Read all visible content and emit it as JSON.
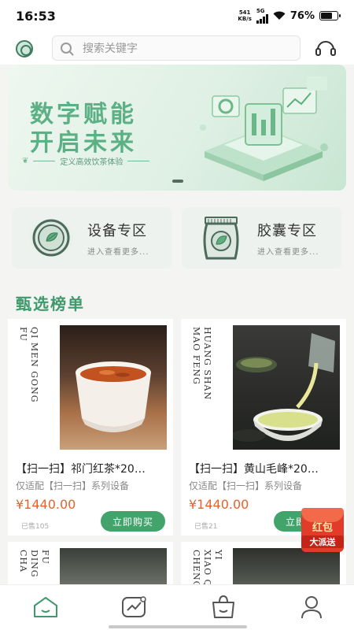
{
  "status_bar": {
    "time": "16:53",
    "net_speed_value": "541",
    "net_speed_unit": "KB/s",
    "network": "5G",
    "battery": "76%",
    "battery_level": 0.76
  },
  "header": {
    "search_placeholder": "搜索关键字",
    "icons": [
      "logo-icon",
      "search-icon",
      "headset-icon"
    ]
  },
  "banner": {
    "title_line1": "数字赋能",
    "title_line2": "开启未来",
    "subtitle": "定义高效饮茶体验",
    "page_count": 2,
    "active_page": 2
  },
  "categories": [
    {
      "name": "设备专区",
      "desc": "进入查看更多...",
      "icon": "tea-cup-icon"
    },
    {
      "name": "胶囊专区",
      "desc": "进入查看更多...",
      "icon": "capsule-bag-icon"
    }
  ],
  "section": {
    "title": "甄选榜单"
  },
  "products": [
    {
      "vertical_label_col1": "QI MEN GONG",
      "vertical_label_col2": "FU",
      "name": "【扫一扫】祁门红茶*20…",
      "desc": "仅适配【扫一扫】系列设备",
      "price": "¥1440.00",
      "sold": "已售105",
      "button": "立即购买"
    },
    {
      "vertical_label_col1": "HUANG SHAN",
      "vertical_label_col2": "MAO FENG",
      "name": "【扫一扫】黄山毛峰*20…",
      "desc": "仅适配【扫一扫】系列设备",
      "price": "¥1440.00",
      "sold": "已售21",
      "button": "立即购买"
    },
    {
      "vertical_label_col1": "FU DING",
      "vertical_label_col2": "CHA"
    },
    {
      "vertical_label_col1": "YI XIAO Q",
      "vertical_label_col2": "CHENG"
    }
  ],
  "red_packet": {
    "line1": "红包",
    "line2": "大派送"
  },
  "tabbar": {
    "icons": [
      "home-icon",
      "trend-icon",
      "shopping-bag-icon",
      "user-icon"
    ],
    "active_color": "#3e9a6c"
  },
  "colors": {
    "brand_green": "#42a36b",
    "price_orange": "#e5622c",
    "title_green": "#3e9a6c"
  }
}
